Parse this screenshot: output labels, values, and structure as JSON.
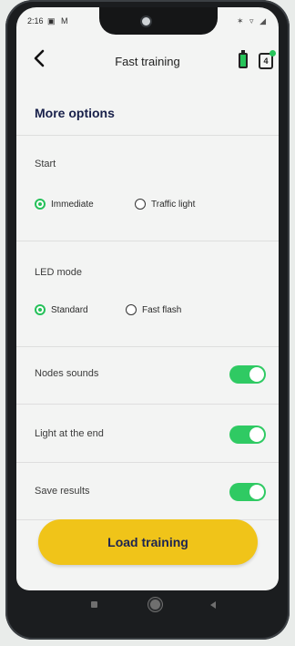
{
  "status_bar": {
    "time": "2:16",
    "left_icons": "▣ M",
    "right_icons": "✶ ▿ ◢"
  },
  "nav": {
    "title": "Fast training",
    "node_count": "4"
  },
  "section_title": "More options",
  "start": {
    "label": "Start",
    "options": [
      {
        "label": "Immediate",
        "selected": true
      },
      {
        "label": "Traffic light",
        "selected": false
      }
    ]
  },
  "led_mode": {
    "label": "LED mode",
    "options": [
      {
        "label": "Standard",
        "selected": true
      },
      {
        "label": "Fast flash",
        "selected": false
      }
    ]
  },
  "toggles": [
    {
      "label": "Nodes sounds",
      "on": true
    },
    {
      "label": "Light at the end",
      "on": true
    },
    {
      "label": "Save results",
      "on": true
    }
  ],
  "load_button": "Load training",
  "colors": {
    "accent_green": "#2fca63",
    "button_yellow": "#f0c419",
    "title_navy": "#18204a"
  }
}
